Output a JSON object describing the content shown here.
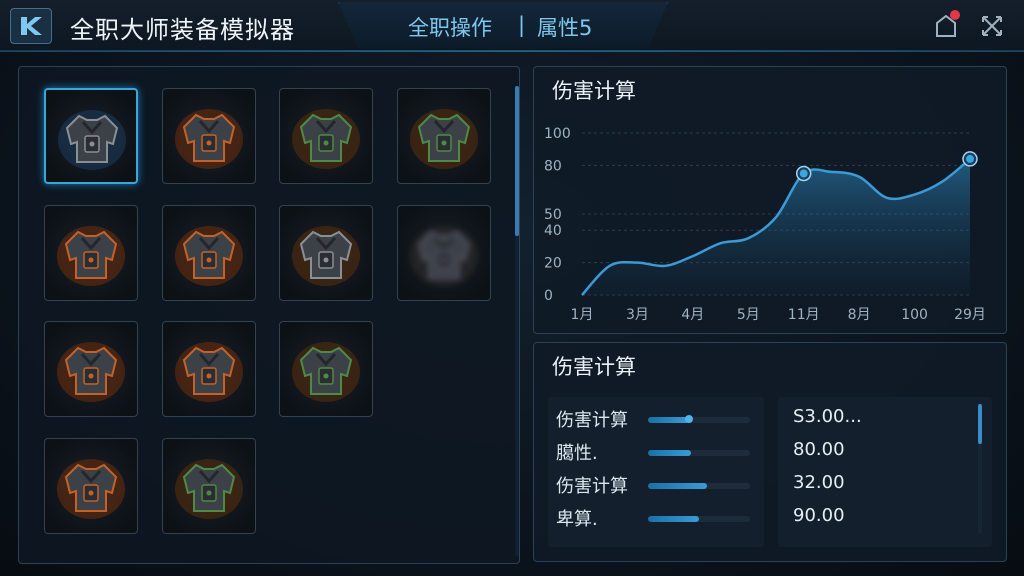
{
  "header": {
    "app_title": "全职大师装备模拟器",
    "mode_label": "全职操作",
    "separator": "|",
    "attribute_label": "属性5"
  },
  "equipment_grid": {
    "slots": [
      {
        "name": "armor-1",
        "selected": true
      },
      {
        "name": "armor-2"
      },
      {
        "name": "armor-3"
      },
      {
        "name": "armor-4"
      },
      {
        "name": "armor-5"
      },
      {
        "name": "armor-6"
      },
      {
        "name": "armor-7"
      },
      {
        "name": "armor-8"
      },
      {
        "name": "armor-9"
      },
      {
        "name": "armor-10"
      },
      {
        "name": "armor-11"
      },
      {
        "name": "armor-12"
      },
      {
        "name": "armor-13"
      }
    ]
  },
  "chart_panel": {
    "title": "伤害计算"
  },
  "chart_data": {
    "type": "area",
    "title": "伤害计算",
    "categories": [
      "1月",
      "3月",
      "4月",
      "5月",
      "11月",
      "8月",
      "100",
      "29月"
    ],
    "yticks": [
      0,
      20,
      40,
      50,
      80,
      100
    ],
    "ylim": [
      0,
      100
    ],
    "series": [
      {
        "x": [
          0,
          0.5,
          1,
          1.5,
          2,
          2.5,
          3,
          3.5,
          4,
          4.5,
          5,
          5.5,
          6,
          6.5,
          7
        ],
        "values": [
          0,
          18,
          20,
          18,
          24,
          32,
          35,
          48,
          75,
          76,
          73,
          60,
          62,
          70,
          84
        ]
      }
    ],
    "highlight_points": [
      {
        "x": 4,
        "y": 75
      },
      {
        "x": 7,
        "y": 84
      }
    ],
    "grid": true
  },
  "info_panel": {
    "title": "伤害计算",
    "stats": [
      {
        "label": "伤害计算",
        "bar": 0.4,
        "value": "S3.00..."
      },
      {
        "label": "臈性.",
        "bar": 0.42,
        "value": "80.00"
      },
      {
        "label": "伤害计算",
        "bar": 0.58,
        "value": "32.00"
      },
      {
        "label": "卑算.",
        "bar": 0.5,
        "value": "90.00"
      }
    ]
  },
  "colors": {
    "accent": "#3aa6dd",
    "line": "#3a9bd6",
    "notification": "#e5374a"
  }
}
